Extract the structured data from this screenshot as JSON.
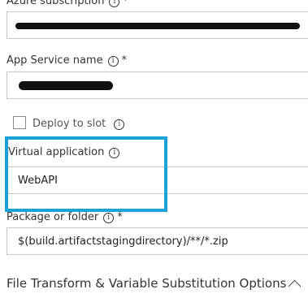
{
  "azure_subscription": {
    "label": "Azure subscription",
    "required_mark": "*"
  },
  "app_service_name": {
    "label": "App Service name",
    "required_mark": "*"
  },
  "deploy_to_slot": {
    "label": "Deploy to slot",
    "checked": false
  },
  "virtual_application": {
    "label": "Virtual application",
    "value": "WebAPI"
  },
  "package_or_folder": {
    "label": "Package or folder",
    "required_mark": "*",
    "value": "$(build.artifactstagingdirectory)/**/*.zip"
  },
  "section": {
    "title": "File Transform & Variable Substitution Options",
    "expanded": true
  },
  "colors": {
    "highlight": "#1aa3d9",
    "border": "#c8c8c8",
    "text": "#333333"
  },
  "icons": {
    "info": "info-icon",
    "chevron": "chevron-up-icon"
  }
}
